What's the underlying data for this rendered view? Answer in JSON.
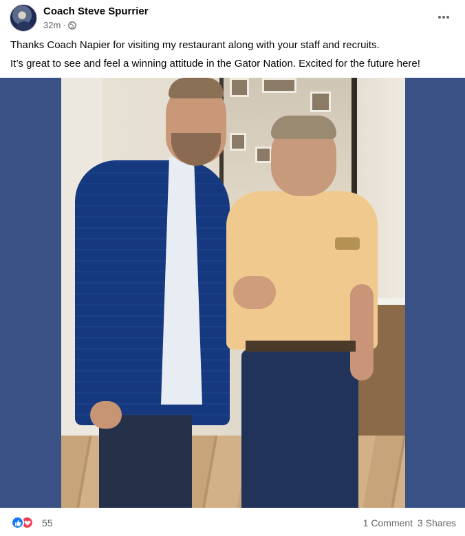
{
  "post": {
    "author": "Coach Steve Spurrier",
    "time": "32m",
    "visibility_icon": "globe-icon",
    "more_icon": "more-horizontal-icon",
    "lines": [
      "Thanks Coach Napier for visiting my restaurant along with your staff and recruits.",
      "It’s great to see and feel a winning attitude in the Gator Nation. Excited for the future here!"
    ]
  },
  "photo": {
    "frame_color": "#3a5186"
  },
  "engagement": {
    "reaction_icons": [
      "like-icon",
      "love-icon"
    ],
    "reaction_count": "55",
    "comments": "1 Comment",
    "shares": "3 Shares"
  },
  "colors": {
    "text_primary": "#050505",
    "text_secondary": "#65676b",
    "like_blue": "#1877f2",
    "love_red": "#f33e58"
  }
}
